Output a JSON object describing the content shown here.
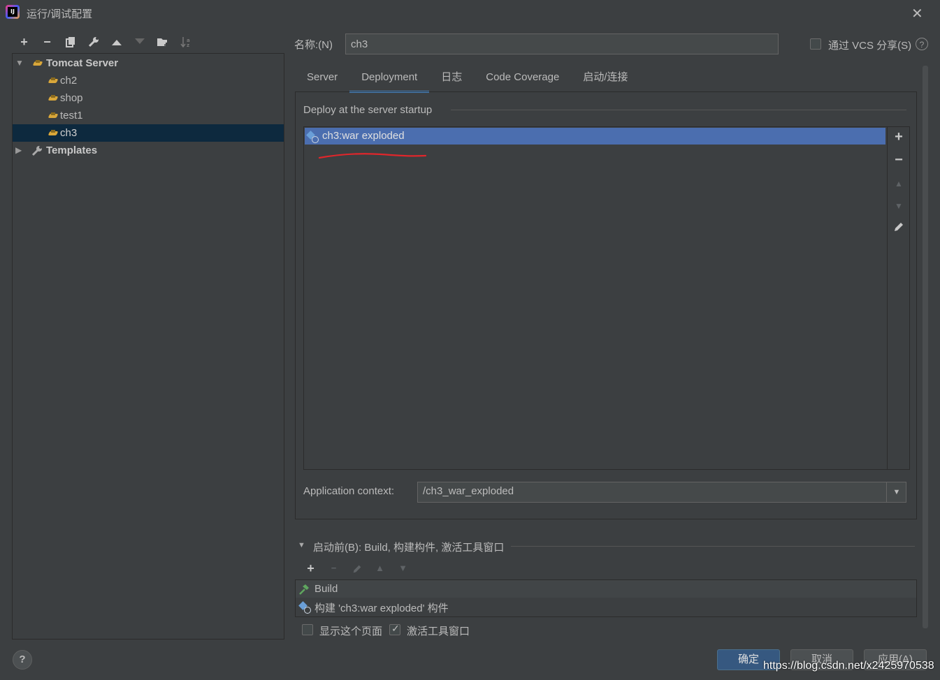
{
  "window": {
    "title": "运行/调试配置"
  },
  "toolbar": {
    "items": [
      "add-icon",
      "remove-icon",
      "copy-icon",
      "wrench-icon",
      "move-up-icon",
      "move-down-icon",
      "folder-add-icon",
      "sort-icon"
    ]
  },
  "tree": {
    "group_label": "Tomcat Server",
    "items": [
      "ch2",
      "shop",
      "test1",
      "ch3"
    ],
    "selected": "ch3",
    "templates_label": "Templates"
  },
  "name": {
    "label": "名称:(N)",
    "value": "ch3"
  },
  "vcs": {
    "label": "通过 VCS 分享(S)",
    "checked": false
  },
  "tabs": [
    "Server",
    "Deployment",
    "日志",
    "Code Coverage",
    "启动/连接"
  ],
  "active_tab": "Deployment",
  "deploy": {
    "group_title": "Deploy at the server startup",
    "items": [
      "ch3:war exploded"
    ],
    "selected": "ch3:war exploded"
  },
  "context": {
    "label": "Application context:",
    "value": "/ch3_war_exploded"
  },
  "before_launch": {
    "title": "启动前(B): Build, 构建构件, 激活工具窗口",
    "items": [
      "Build",
      "构建 'ch3:war exploded' 构件"
    ]
  },
  "options": {
    "show_page": {
      "label": "显示这个页面",
      "checked": false
    },
    "activate_tool": {
      "label": "激活工具窗口",
      "checked": true
    }
  },
  "buttons": {
    "ok": "确定",
    "cancel": "取消",
    "apply": "应用(A)"
  },
  "watermark": "https://blog.csdn.net/x2425970538",
  "colors": {
    "selection": "#4b6eaf",
    "tab_underline": "#4a88c7",
    "primary_button": "#365880",
    "annotation": "#e0262b"
  }
}
